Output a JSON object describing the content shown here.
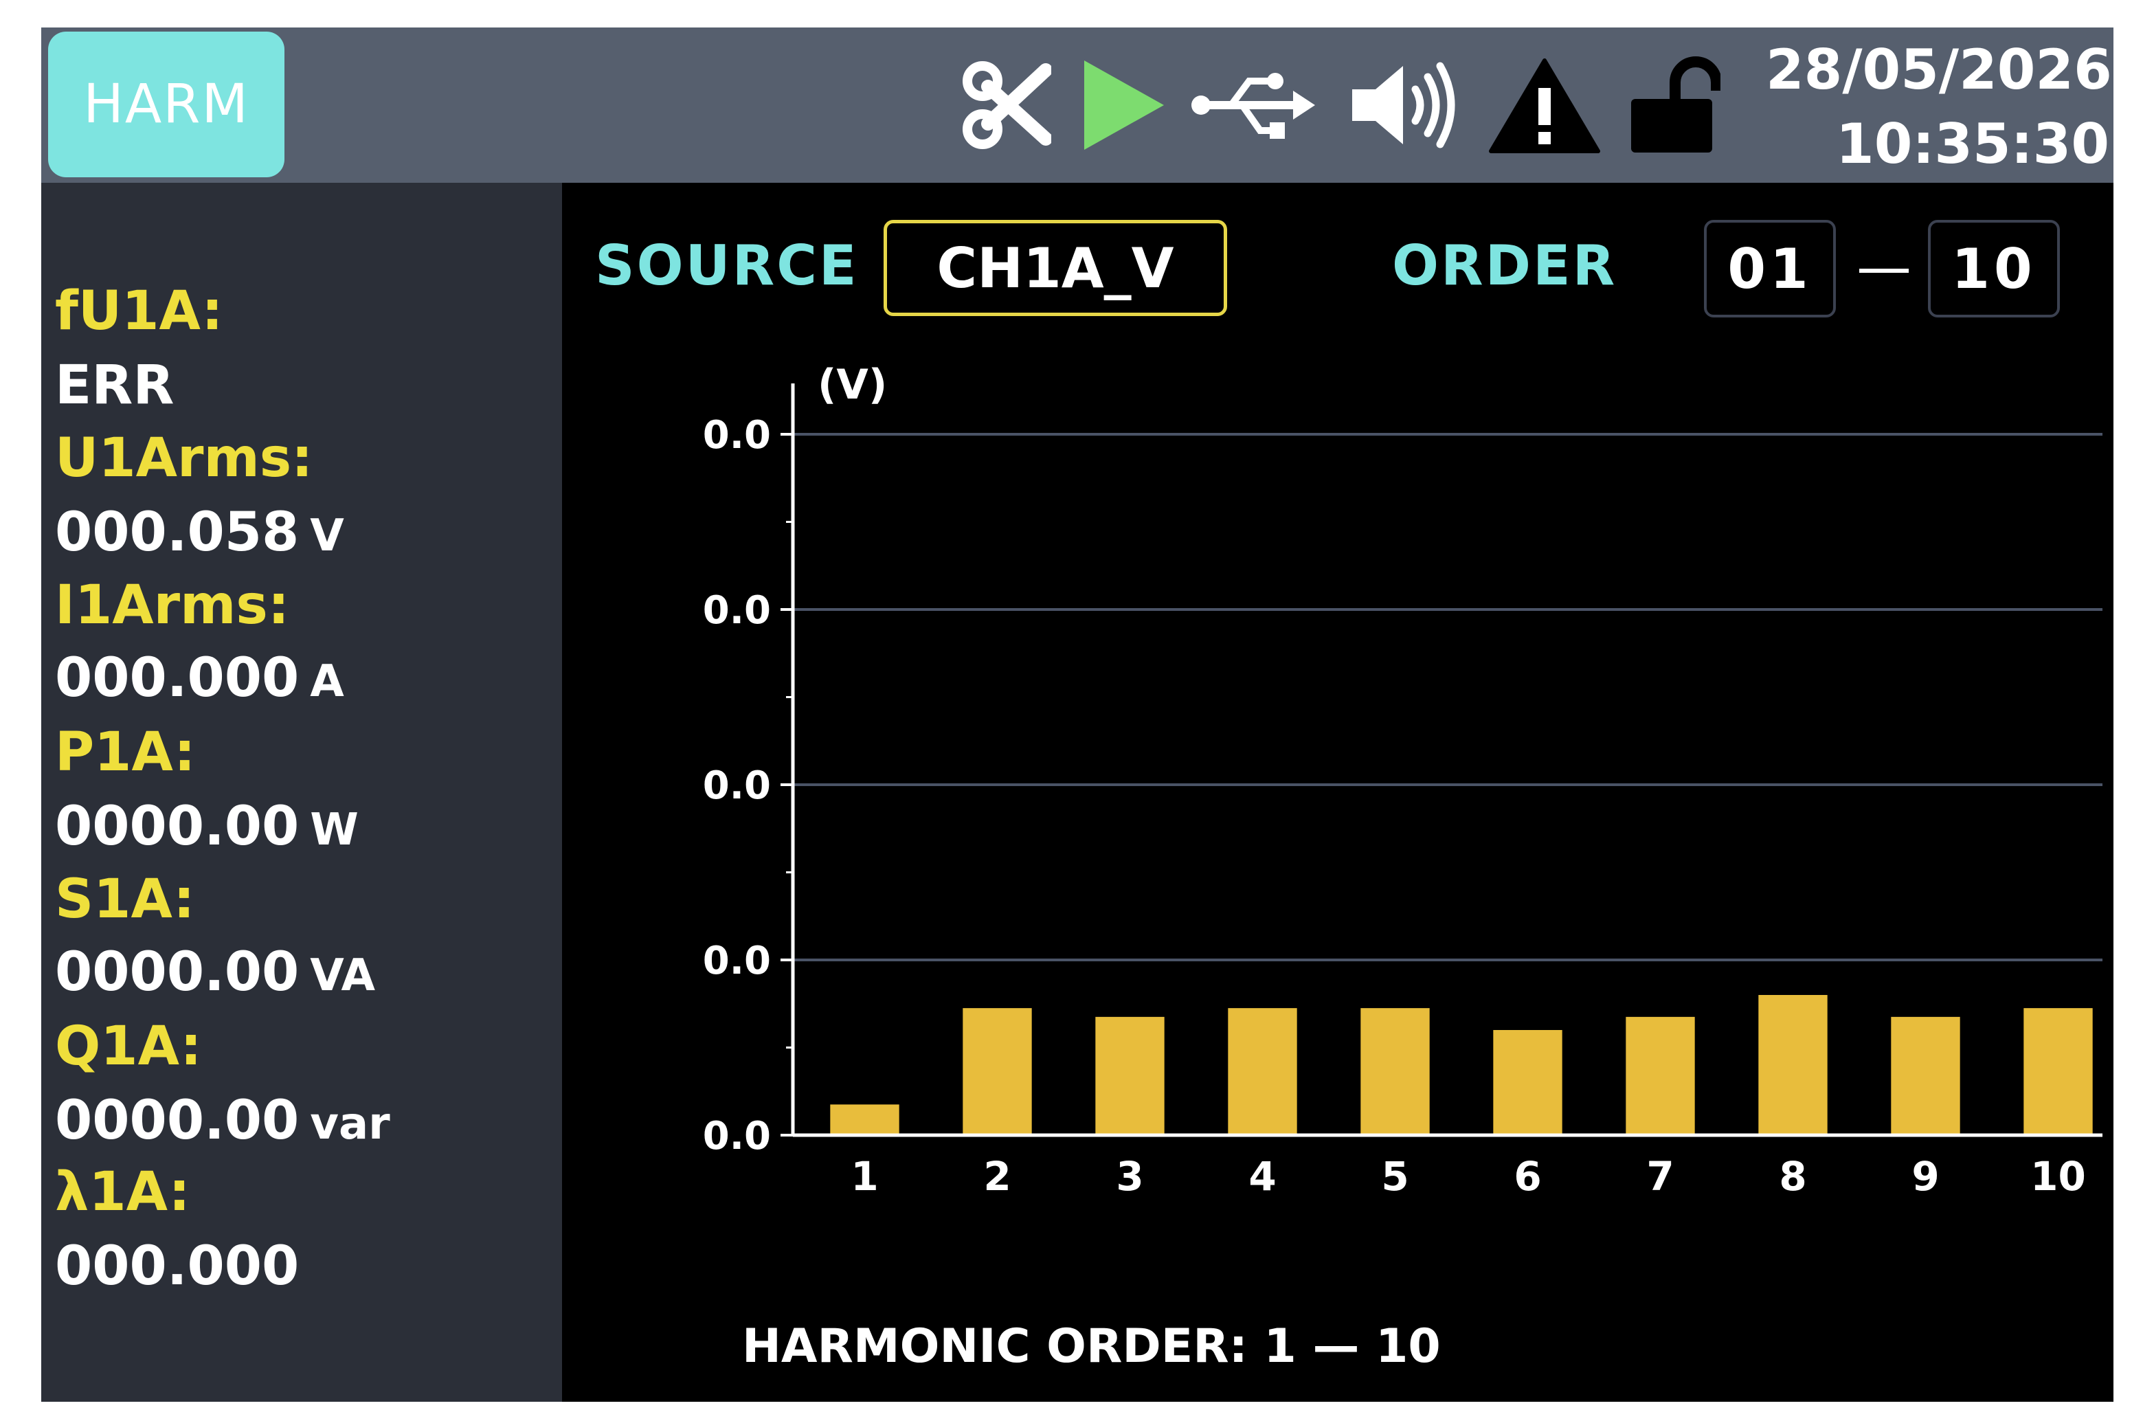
{
  "topbar": {
    "mode_label": "HARM",
    "date": "28/05/2026",
    "time": "10:35:30",
    "icons": [
      "scissors-icon",
      "play-icon",
      "usb-icon",
      "speaker-icon",
      "warning-icon",
      "unlock-icon"
    ],
    "play_color": "#7ddc6f"
  },
  "left_panel": {
    "items": [
      {
        "label": "fU1A:",
        "value": "ERR",
        "unit": ""
      },
      {
        "label": "U1Arms:",
        "value": "000.058",
        "unit": "V"
      },
      {
        "label": "I1Arms:",
        "value": "000.000",
        "unit": "A"
      },
      {
        "label": "P1A:",
        "value": "0000.00",
        "unit": "W"
      },
      {
        "label": "S1A:",
        "value": "0000.00",
        "unit": "VA"
      },
      {
        "label": "Q1A:",
        "value": "0000.00",
        "unit": "var"
      },
      {
        "label": "λ1A:",
        "value": "000.000",
        "unit": ""
      }
    ],
    "label_color": "#efdf3c"
  },
  "header": {
    "source_label": "SOURCE",
    "source_value": "CH1A_V",
    "order_label": "ORDER",
    "order_from": "01",
    "order_to": "10"
  },
  "caption": "HARMONIC ORDER: 1 — 10",
  "chart_data": {
    "type": "bar",
    "unit_label": "(V)",
    "categories": [
      "1",
      "2",
      "3",
      "4",
      "5",
      "6",
      "7",
      "8",
      "9",
      "10"
    ],
    "values": [
      0.007,
      0.029,
      0.027,
      0.029,
      0.029,
      0.024,
      0.027,
      0.032,
      0.027,
      0.029
    ],
    "ylim": [
      0,
      0.16
    ],
    "yticks": [
      0,
      0.04,
      0.08,
      0.12,
      0.16
    ],
    "ytick_labels": [
      "0.0",
      "0.0",
      "0.0",
      "0.0",
      "0.0"
    ],
    "grid": true,
    "bar_color": "#e8bd3c"
  }
}
